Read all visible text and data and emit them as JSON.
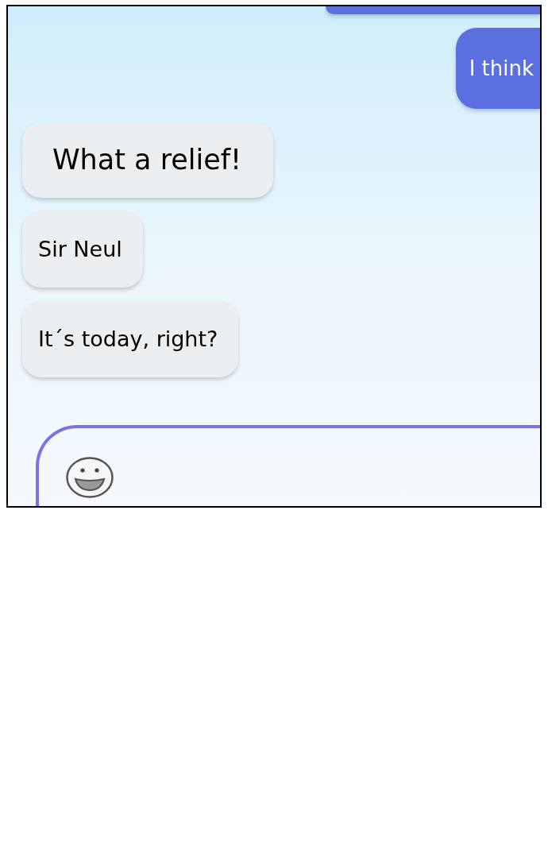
{
  "messages": [
    {
      "kind": "sent"
    },
    {
      "kind": "sent",
      "emphasized": false,
      "text": "I think"
    },
    {
      "kind": "received",
      "emphasized": true,
      "text": "What a relief!"
    },
    {
      "kind": "received",
      "emphasized": false,
      "text": "Sir Neul"
    },
    {
      "kind": "received",
      "emphasized": false,
      "text": "It´s today, right?"
    }
  ]
}
